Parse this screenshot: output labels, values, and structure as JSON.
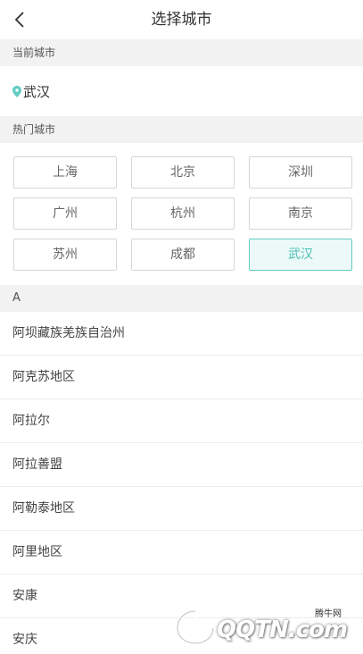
{
  "nav": {
    "title": "选择城市"
  },
  "current": {
    "header": "当前城市",
    "city": "武汉"
  },
  "hot": {
    "header": "热门城市",
    "cities": [
      "上海",
      "北京",
      "深圳",
      "广州",
      "杭州",
      "南京",
      "苏州",
      "成都",
      "武汉"
    ],
    "selected": "武汉"
  },
  "list": {
    "letter": "A",
    "cities": [
      "阿坝藏族羌族自治州",
      "阿克苏地区",
      "阿拉尔",
      "阿拉善盟",
      "阿勒泰地区",
      "阿里地区",
      "安康",
      "安庆"
    ]
  },
  "watermark": {
    "brand": "QQTN.com",
    "caption": "腾牛网"
  },
  "colors": {
    "accent": "#63cbc3",
    "section_bg": "#f2f2f2"
  }
}
